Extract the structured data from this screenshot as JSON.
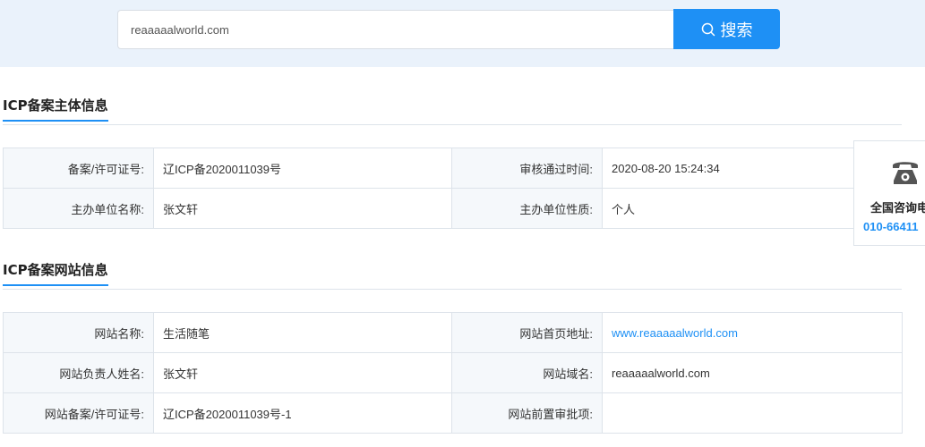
{
  "search": {
    "value": "reaaaaalworld.com",
    "button_label": "搜索"
  },
  "subject_section": {
    "title": "ICP备案主体信息",
    "rows": [
      {
        "label1": "备案/许可证号:",
        "value1": "辽ICP备2020011039号",
        "label2": "审核通过时间:",
        "value2": "2020-08-20 15:24:34"
      },
      {
        "label1": "主办单位名称:",
        "value1": "张文轩",
        "label2": "主办单位性质:",
        "value2": "个人"
      }
    ]
  },
  "site_section": {
    "title": "ICP备案网站信息",
    "rows": [
      {
        "label1": "网站名称:",
        "value1": "生活随笔",
        "label2": "网站首页地址:",
        "value2": "www.reaaaaalworld.com"
      },
      {
        "label1": "网站负责人姓名:",
        "value1": "张文轩",
        "label2": "网站域名:",
        "value2": "reaaaaalworld.com"
      },
      {
        "label1": "网站备案/许可证号:",
        "value1": "辽ICP备2020011039号-1",
        "label2": "网站前置审批项:",
        "value2": ""
      }
    ]
  },
  "contact": {
    "icon": "phone-icon",
    "title": "全国咨询电",
    "number": "010-66411"
  },
  "colors": {
    "accent": "#1e90f5",
    "band": "#eaf2fb",
    "label_bg": "#f5f8fb",
    "border": "#dde3ea"
  }
}
